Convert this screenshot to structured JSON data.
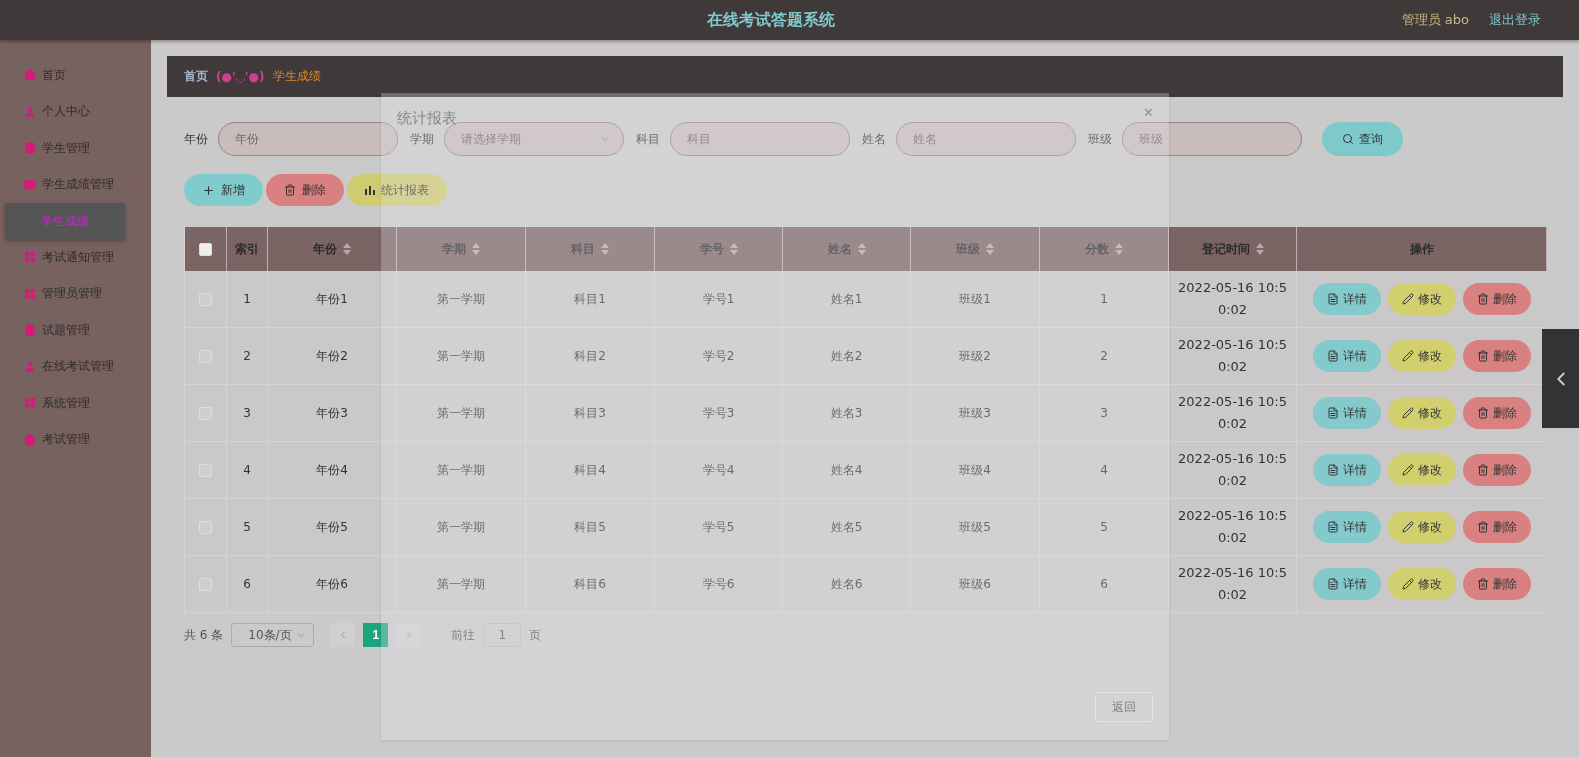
{
  "header": {
    "title": "在线考试答题系统",
    "user": "管理员 abo",
    "logout": "退出登录"
  },
  "sidebar": {
    "items": [
      {
        "kind": "home",
        "label": "首页",
        "selected": false
      },
      {
        "kind": "person",
        "label": "个人中心",
        "selected": false,
        "expanded": false
      },
      {
        "kind": "book",
        "label": "学生管理",
        "selected": false,
        "expanded": false
      },
      {
        "kind": "chat",
        "label": "学生成绩管理",
        "selected": false,
        "expanded": true,
        "children": [
          {
            "label": "学生成绩",
            "selected": true
          }
        ]
      },
      {
        "kind": "grid",
        "label": "考试通知管理",
        "selected": false,
        "expanded": false
      },
      {
        "kind": "grid",
        "label": "管理员管理",
        "selected": false,
        "expanded": false
      },
      {
        "kind": "clipboard",
        "label": "试题管理",
        "selected": false,
        "expanded": false
      },
      {
        "kind": "person",
        "label": "在线考试管理",
        "selected": false,
        "expanded": false
      },
      {
        "kind": "grid",
        "label": "系统管理",
        "selected": false,
        "expanded": false
      },
      {
        "kind": "check",
        "label": "考试管理",
        "selected": false,
        "expanded": false
      }
    ]
  },
  "breadcrumb": {
    "home": "首页",
    "separator": "(●'◡'●)",
    "current": "学生成绩"
  },
  "search": {
    "fields": [
      {
        "kind": "text",
        "label": "年份",
        "placeholder": "年份"
      },
      {
        "kind": "select",
        "label": "学期",
        "placeholder": "请选择学期"
      },
      {
        "kind": "text",
        "label": "科目",
        "placeholder": "科目"
      },
      {
        "kind": "text",
        "label": "姓名",
        "placeholder": "姓名"
      },
      {
        "kind": "text",
        "label": "班级",
        "placeholder": "班级"
      }
    ],
    "button": "查询"
  },
  "actions": [
    {
      "kind": "add",
      "label": "新增"
    },
    {
      "kind": "delete",
      "label": "删除"
    },
    {
      "kind": "report",
      "label": "统计报表"
    }
  ],
  "table": {
    "all_checked": false,
    "columns": [
      {
        "label": "索引",
        "sortable": false
      },
      {
        "label": "年份",
        "sortable": true
      },
      {
        "label": "学期",
        "sortable": true
      },
      {
        "label": "科目",
        "sortable": true
      },
      {
        "label": "学号",
        "sortable": true
      },
      {
        "label": "姓名",
        "sortable": true
      },
      {
        "label": "班级",
        "sortable": true
      },
      {
        "label": "分数",
        "sortable": true
      },
      {
        "label": "登记时间",
        "sortable": true
      },
      {
        "label": "操作",
        "sortable": false
      }
    ],
    "rows": [
      {
        "checked": false,
        "cells": [
          "1",
          "年份1",
          "第一学期",
          "科目1",
          "学号1",
          "姓名1",
          "班级1",
          "1",
          "2022-05-16 10:50:02"
        ],
        "buttons": [
          {
            "kind": "detail",
            "label": "详情"
          },
          {
            "kind": "edit",
            "label": "修改"
          },
          {
            "kind": "delete",
            "label": "删除"
          }
        ]
      },
      {
        "checked": false,
        "cells": [
          "2",
          "年份2",
          "第一学期",
          "科目2",
          "学号2",
          "姓名2",
          "班级2",
          "2",
          "2022-05-16 10:50:02"
        ],
        "buttons": [
          {
            "kind": "detail",
            "label": "详情"
          },
          {
            "kind": "edit",
            "label": "修改"
          },
          {
            "kind": "delete",
            "label": "删除"
          }
        ]
      },
      {
        "checked": false,
        "cells": [
          "3",
          "年份3",
          "第一学期",
          "科目3",
          "学号3",
          "姓名3",
          "班级3",
          "3",
          "2022-05-16 10:50:02"
        ],
        "buttons": [
          {
            "kind": "detail",
            "label": "详情"
          },
          {
            "kind": "edit",
            "label": "修改"
          },
          {
            "kind": "delete",
            "label": "删除"
          }
        ]
      },
      {
        "checked": false,
        "cells": [
          "4",
          "年份4",
          "第一学期",
          "科目4",
          "学号4",
          "姓名4",
          "班级4",
          "4",
          "2022-05-16 10:50:02"
        ],
        "buttons": [
          {
            "kind": "detail",
            "label": "详情"
          },
          {
            "kind": "edit",
            "label": "修改"
          },
          {
            "kind": "delete",
            "label": "删除"
          }
        ]
      },
      {
        "checked": false,
        "cells": [
          "5",
          "年份5",
          "第一学期",
          "科目5",
          "学号5",
          "姓名5",
          "班级5",
          "5",
          "2022-05-16 10:50:02"
        ],
        "buttons": [
          {
            "kind": "detail",
            "label": "详情"
          },
          {
            "kind": "edit",
            "label": "修改"
          },
          {
            "kind": "delete",
            "label": "删除"
          }
        ]
      },
      {
        "checked": false,
        "cells": [
          "6",
          "年份6",
          "第一学期",
          "科目6",
          "学号6",
          "姓名6",
          "班级6",
          "6",
          "2022-05-16 10:50:02"
        ],
        "buttons": [
          {
            "kind": "detail",
            "label": "详情"
          },
          {
            "kind": "edit",
            "label": "修改"
          },
          {
            "kind": "delete",
            "label": "删除"
          }
        ]
      }
    ]
  },
  "pagination": {
    "total": "共 6 条",
    "page_size": "10条/页",
    "pages": [
      {
        "label": "1",
        "selected": true
      }
    ],
    "goto": "前往",
    "goto_value": "1",
    "suffix": "页"
  },
  "dialog": {
    "title": "统计报表",
    "close": "×",
    "button": "返回"
  }
}
